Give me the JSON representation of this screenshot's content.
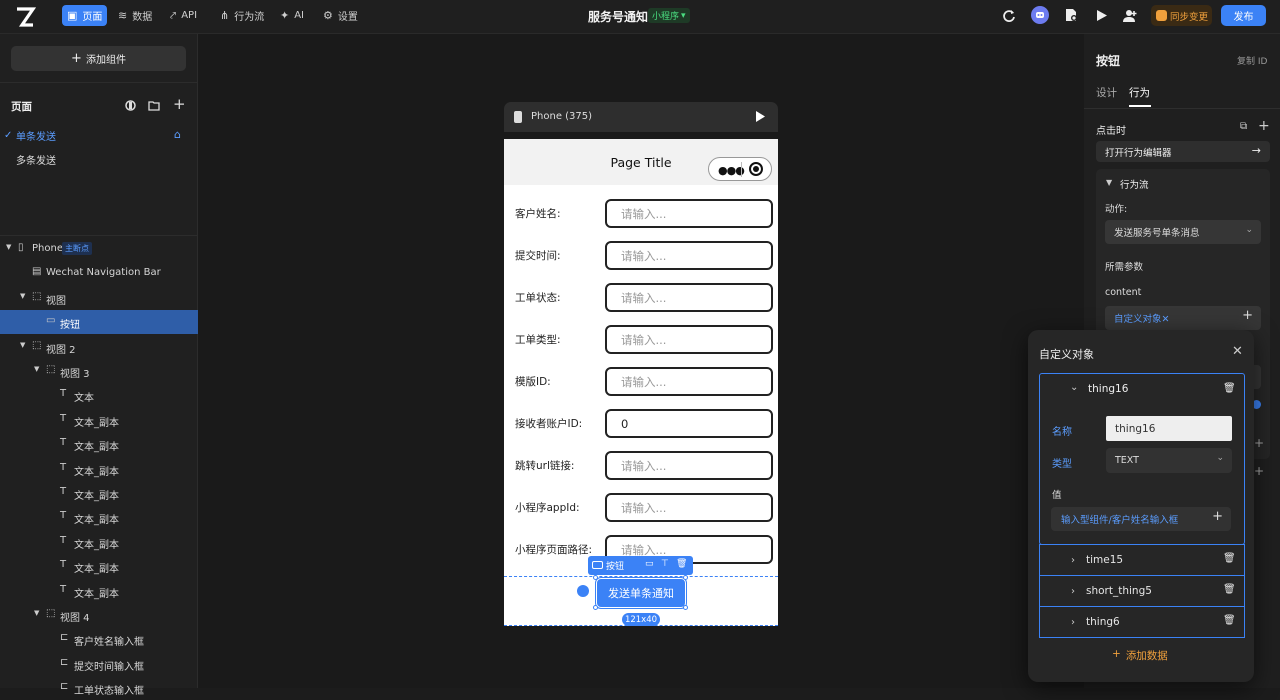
{
  "topbar": {
    "nav": [
      {
        "label": "页面",
        "icon": "page-icon"
      },
      {
        "label": "数据",
        "icon": "database-icon"
      },
      {
        "label": "API",
        "icon": "api-icon"
      },
      {
        "label": "行为流",
        "icon": "flow-icon"
      },
      {
        "label": "AI",
        "icon": "ai-icon"
      },
      {
        "label": "设置",
        "icon": "gear-icon"
      }
    ],
    "title": "服务号通知",
    "app_type": "小程序",
    "sync_label": "同步变更",
    "publish_label": "发布"
  },
  "left": {
    "add_component": "添加组件",
    "pages_title": "页面",
    "pages": [
      {
        "label": "单条发送",
        "active": true
      },
      {
        "label": "多条发送",
        "active": false
      }
    ],
    "tree": [
      {
        "label": "Phone",
        "badge": "主断点",
        "depth": 0,
        "caret": true,
        "icon": "phone-icon"
      },
      {
        "label": "Wechat Navigation Bar",
        "depth": 1,
        "caret": false,
        "icon": "navbar-icon"
      },
      {
        "label": "视图",
        "depth": 1,
        "caret": true,
        "icon": "view-icon"
      },
      {
        "label": "按钮",
        "depth": 2,
        "caret": false,
        "icon": "button-icon",
        "selected": true
      },
      {
        "label": "视图 2",
        "depth": 1,
        "caret": true,
        "icon": "view-icon"
      },
      {
        "label": "视图 3",
        "depth": 2,
        "caret": true,
        "icon": "view-icon"
      },
      {
        "label": "文本",
        "depth": 3,
        "caret": false,
        "icon": "text-icon"
      },
      {
        "label": "文本_副本",
        "depth": 3,
        "caret": false,
        "icon": "text-icon"
      },
      {
        "label": "文本_副本",
        "depth": 3,
        "caret": false,
        "icon": "text-icon"
      },
      {
        "label": "文本_副本",
        "depth": 3,
        "caret": false,
        "icon": "text-icon"
      },
      {
        "label": "文本_副本",
        "depth": 3,
        "caret": false,
        "icon": "text-icon"
      },
      {
        "label": "文本_副本",
        "depth": 3,
        "caret": false,
        "icon": "text-icon"
      },
      {
        "label": "文本_副本",
        "depth": 3,
        "caret": false,
        "icon": "text-icon"
      },
      {
        "label": "文本_副本",
        "depth": 3,
        "caret": false,
        "icon": "text-icon"
      },
      {
        "label": "文本_副本",
        "depth": 3,
        "caret": false,
        "icon": "text-icon"
      },
      {
        "label": "视图 4",
        "depth": 2,
        "caret": true,
        "icon": "view-icon"
      },
      {
        "label": "客户姓名输入框",
        "depth": 3,
        "caret": false,
        "icon": "input-icon"
      },
      {
        "label": "提交时间输入框",
        "depth": 3,
        "caret": false,
        "icon": "input-icon"
      },
      {
        "label": "工单状态输入框",
        "depth": 3,
        "caret": false,
        "icon": "input-icon"
      }
    ]
  },
  "canvas": {
    "device_label": "Phone (375)",
    "page_title": "Page Title",
    "fields": [
      {
        "label": "客户姓名:",
        "placeholder": "请输入...",
        "value": ""
      },
      {
        "label": "提交时间:",
        "placeholder": "请输入...",
        "value": ""
      },
      {
        "label": "工单状态:",
        "placeholder": "请输入...",
        "value": ""
      },
      {
        "label": "工单类型:",
        "placeholder": "请输入...",
        "value": ""
      },
      {
        "label": "模版ID:",
        "placeholder": "请输入...",
        "value": ""
      },
      {
        "label": "接收者账户ID:",
        "placeholder": "",
        "value": "0"
      },
      {
        "label": "跳转url链接:",
        "placeholder": "请输入...",
        "value": ""
      },
      {
        "label": "小程序appId:",
        "placeholder": "请输入...",
        "value": ""
      },
      {
        "label": "小程序页面路径:",
        "placeholder": "请输入...",
        "value": ""
      }
    ],
    "selection_tag": "按钮",
    "button_label": "发送单条通知",
    "size_badge": "121x40"
  },
  "right": {
    "title": "按钮",
    "copy_id": "复制 ID",
    "tabs": [
      "设计",
      "行为"
    ],
    "active_tab": "行为",
    "on_click": "点击时",
    "open_editor": "打开行为编辑器",
    "flow_title": "行为流",
    "action_label": "动作:",
    "action_value": "发送服务号单条消息",
    "params_title": "所需参数",
    "param_name": "content",
    "param_value": "自定义对象✕"
  },
  "popup": {
    "title": "自定义对象",
    "items": [
      "thing16",
      "time15",
      "short_thing5",
      "thing6"
    ],
    "name_label": "名称",
    "name_value": "thing16",
    "type_label": "类型",
    "type_value": "TEXT",
    "value_label": "值",
    "value_binding": "输入型组件/客户姓名输入框",
    "add_data": "添加数据"
  },
  "colors": {
    "accent": "#3b82f6",
    "sync": "#f0a03c",
    "app_badge": "#4ade80"
  }
}
